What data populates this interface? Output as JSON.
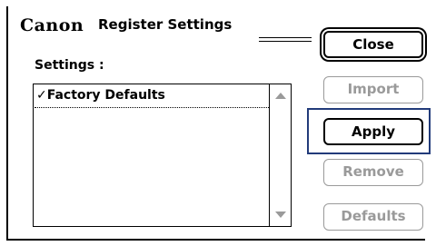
{
  "dialog": {
    "brand": "Canon",
    "title": "Register Settings"
  },
  "settings": {
    "label": "Settings :",
    "items": [
      {
        "label": "✓Factory Defaults",
        "selected": true
      }
    ]
  },
  "buttons": {
    "close": "Close",
    "import": "Import",
    "apply": "Apply",
    "remove": "Remove",
    "defaults": "Defaults"
  },
  "colors": {
    "focus_frame": "#223b7a",
    "disabled_text": "#9a9a9a"
  }
}
